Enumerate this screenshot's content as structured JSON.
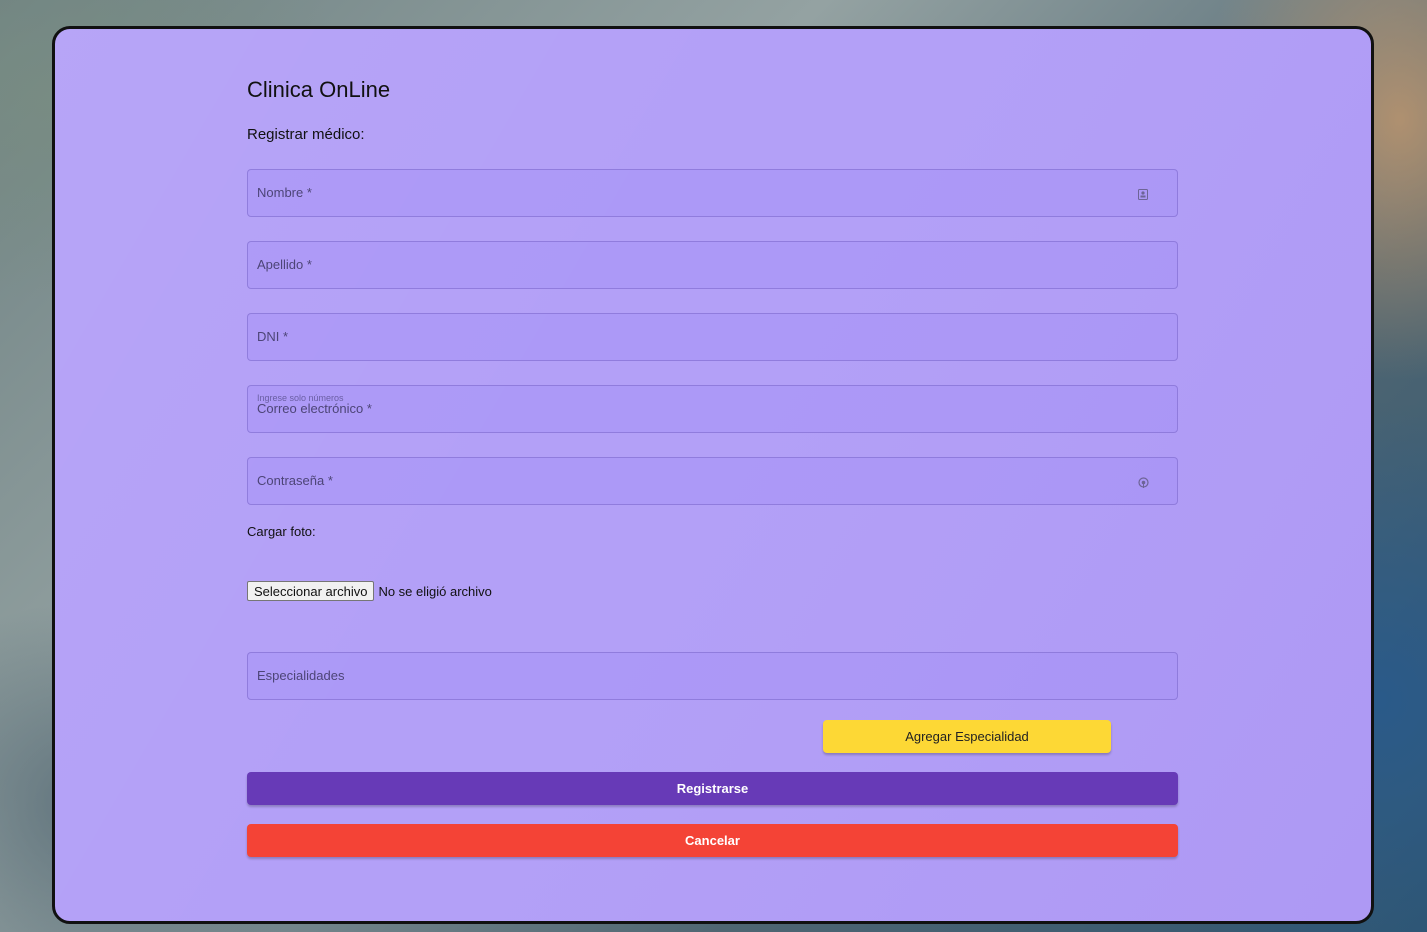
{
  "app": {
    "title": "Clinica OnLine"
  },
  "form": {
    "heading": "Registrar médico:",
    "fields": {
      "nombre": {
        "label": "Nombre *",
        "icon": "contact-card-icon"
      },
      "apellido": {
        "label": "Apellido *"
      },
      "dni": {
        "label": "DNI *",
        "hint": "Ingrese solo números"
      },
      "correo": {
        "label": "Correo electrónico *"
      },
      "contrasena": {
        "label": "Contraseña *",
        "icon": "visibility-icon"
      },
      "especialidades": {
        "label": "Especialidades"
      }
    },
    "upload": {
      "label": "Cargar foto:",
      "button_label": "Seleccionar archivo",
      "status": "No se eligió archivo"
    },
    "buttons": {
      "add_specialty": "Agregar Especialidad",
      "register": "Registrarse",
      "cancel": "Cancelar"
    }
  },
  "colors": {
    "card_background": "#b3a0f7",
    "add_button": "#fdd835",
    "register_button": "#673ab7",
    "cancel_button": "#f44336"
  }
}
